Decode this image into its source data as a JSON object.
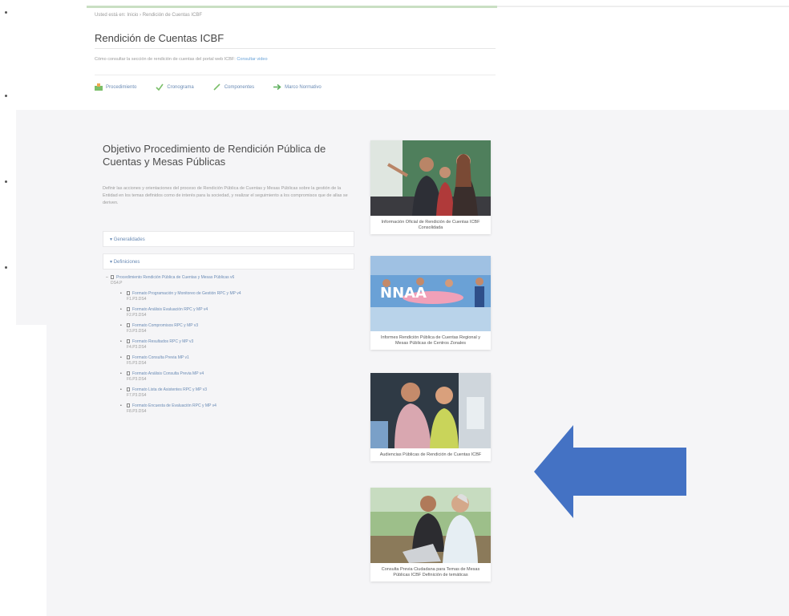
{
  "header": {
    "breadcrumb": "Usted está en:   Inicio › Rendición de Cuentas ICBF",
    "title": "Rendición de Cuentas ICBF",
    "description": "Cómo consultar la sección de rendición de cuentas del portal web ICBF:",
    "description_link": "Consultar video",
    "tabs": [
      {
        "label": "Procedimiento",
        "icon": "procedure-icon"
      },
      {
        "label": "Cronograma",
        "icon": "check-icon"
      },
      {
        "label": "Componentes",
        "icon": "pencil-icon"
      },
      {
        "label": "Marco Normativo",
        "icon": "arrow-right-icon"
      }
    ]
  },
  "content": {
    "title": "Objetivo Procedimiento de Rendición Pública de Cuentas y Mesas Públicas",
    "description": "Definir las acciones y orientaciones del proceso de Rendición Pública de Cuentas y Mesas Públicas sobre la gestión de la Entidad en los temas definidos como de interés para la sociedad, y realizar el seguimiento a los compromisos que de allas se deriven.",
    "accordions": [
      "Generalidades",
      "Definiciones"
    ],
    "documents": {
      "parent": {
        "name": "Procedimiento Rendición Pública de Cuentas y Mesas Públicas v6",
        "code": "DS4.P"
      },
      "children": [
        {
          "name": "Formato Programación y Monitoreo de Gestión RPC y MP v4",
          "code": "F1.P3.DS4"
        },
        {
          "name": "Formato Análisis Evaluación RPC y MP v4",
          "code": "F2.P3.DS4"
        },
        {
          "name": "Formato Compromisos RPC y MP v3",
          "code": "F3.P3.DS4"
        },
        {
          "name": "Formato Resultados RPC y MP v3",
          "code": "F4.P3.DS4"
        },
        {
          "name": "Formato Consulta Previa MP v1",
          "code": "F5.P3.DS4"
        },
        {
          "name": "Formato Análisis Consulta Previa MP v4",
          "code": "F6.P3.DS4"
        },
        {
          "name": "Formato Lista de Asistentes RPC y MP v3",
          "code": "F7.P3.DS4"
        },
        {
          "name": "Formato Encuesta de Evaluación RPC y MP v4",
          "code": "F8.P3.DS4"
        }
      ]
    }
  },
  "cards": [
    {
      "caption": "Información Oficial de Rendición de Cuentas ICBF Consolidada",
      "image": "family-photo"
    },
    {
      "caption": "Informes Rendición Pública de Cuentas Regional y Mesas Públicas de Centros Zonales",
      "image": "event-banner-photo"
    },
    {
      "caption": "Audiencias Públicas de Rendición de Cuentas ICBF",
      "image": "mother-child-photo"
    },
    {
      "caption": "Consulta Previa Ciudadana para Temas de Mesas Públicas ICBF Definición de temáticas",
      "image": "laptop-photo"
    }
  ],
  "colors": {
    "accent_green": "#c9dfc3",
    "link_blue": "#6a8bb5",
    "panel_gray": "#f5f5f7",
    "arrow_blue": "#4472c4"
  }
}
